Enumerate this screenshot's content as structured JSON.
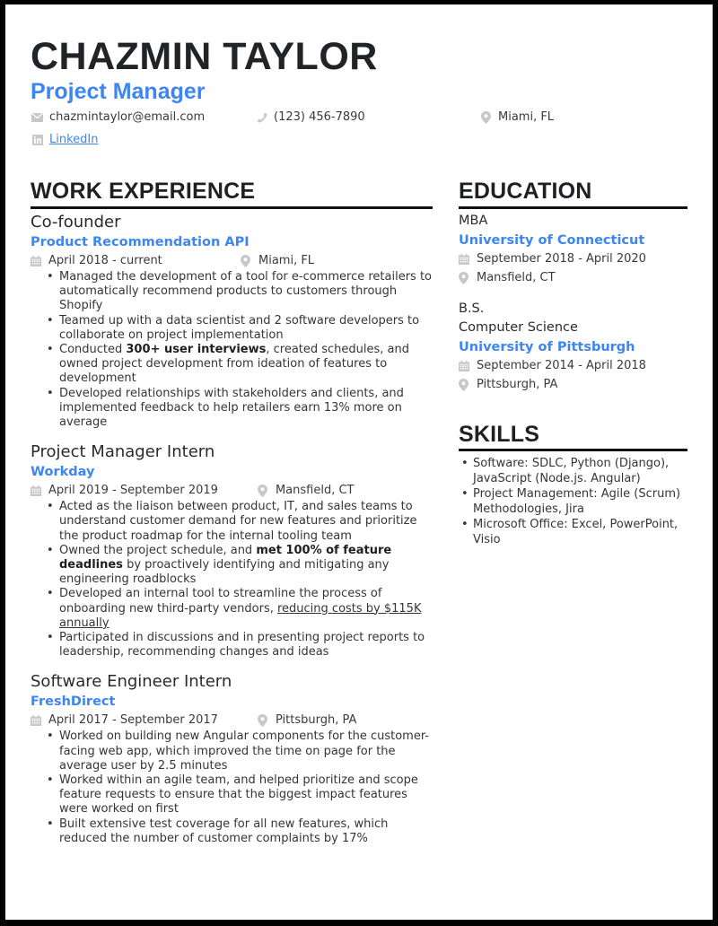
{
  "header": {
    "name": "CHAZMIN TAYLOR",
    "title": "Project Manager",
    "contact": {
      "email": "chazmintaylor@email.com",
      "phone": "(123) 456-7890",
      "location": "Miami, FL",
      "linkedin": "LinkedIn"
    }
  },
  "colors": {
    "accent": "#3d86f2",
    "heading": "#1e2024",
    "icon": "#c8c8c8"
  },
  "work": {
    "heading": "WORK EXPERIENCE",
    "jobs": [
      {
        "role": "Co-founder",
        "org": "Product Recommendation API",
        "dates": "April 2018 - current",
        "location": "Miami, FL",
        "bullets": [
          {
            "pre": "Managed the development of a tool for e-commerce retailers to automatically recommend products to customers through Shopify",
            "bold": "",
            "post": ""
          },
          {
            "pre": "Teamed up with a data scientist and 2 software developers to collaborate on project implementation",
            "bold": "",
            "post": ""
          },
          {
            "pre": "Conducted ",
            "bold": "300+ user interviews",
            "post": ", created schedules, and owned project development from ideation of features to development"
          },
          {
            "pre": "Developed relationships with stakeholders and clients, and implemented feedback to help retailers earn 13% more on average",
            "bold": "",
            "post": ""
          }
        ]
      },
      {
        "role": "Project Manager Intern",
        "org": "Workday",
        "dates": "April 2019 - September 2019",
        "location": "Mansfield, CT",
        "bullets": [
          {
            "pre": "Acted as the liaison between product, IT, and sales teams to understand customer demand for new features and prioritize the product roadmap for the internal tooling team",
            "bold": "",
            "post": ""
          },
          {
            "pre": "Owned the project schedule, and ",
            "bold": "met 100% of feature deadlines",
            "post": " by proactively identifying and mitigating any engineering roadblocks"
          },
          {
            "pre": "Developed an internal tool to streamline the process of onboarding new third-party vendors, ",
            "underline": "reducing costs by $115K annually",
            "post": ""
          },
          {
            "pre": "Participated in discussions and in presenting project reports to leadership, recommending changes and ideas",
            "bold": "",
            "post": ""
          }
        ]
      },
      {
        "role": "Software Engineer Intern",
        "org": "FreshDirect",
        "dates": "April 2017 - September 2017",
        "location": "Pittsburgh, PA",
        "bullets": [
          {
            "pre": "Worked on building new Angular components for the customer-facing web app, which improved the time on page for the average user by 2.5 minutes",
            "bold": "",
            "post": ""
          },
          {
            "pre": "Worked within an agile team, and helped prioritize and scope feature requests to ensure that the biggest impact features were worked on first",
            "bold": "",
            "post": ""
          },
          {
            "pre": "Built extensive test coverage for all new features, which reduced the number of customer complaints by 17%",
            "bold": "",
            "post": ""
          }
        ]
      }
    ]
  },
  "education": {
    "heading": "EDUCATION",
    "items": [
      {
        "degree": "MBA",
        "field": "",
        "school": "University of Connecticut",
        "dates": "September 2018 - April 2020",
        "location": "Mansfield, CT"
      },
      {
        "degree": "B.S.",
        "field": "Computer Science",
        "school": "University of Pittsburgh",
        "dates": "September 2014 - April 2018",
        "location": "Pittsburgh, PA"
      }
    ]
  },
  "skills": {
    "heading": "SKILLS",
    "items": [
      "Software: SDLC, Python (Django), JavaScript (Node.js. Angular)",
      "Project Management: Agile (Scrum) Methodologies, Jira",
      "Microsoft Office: Excel, PowerPoint, Visio"
    ]
  }
}
